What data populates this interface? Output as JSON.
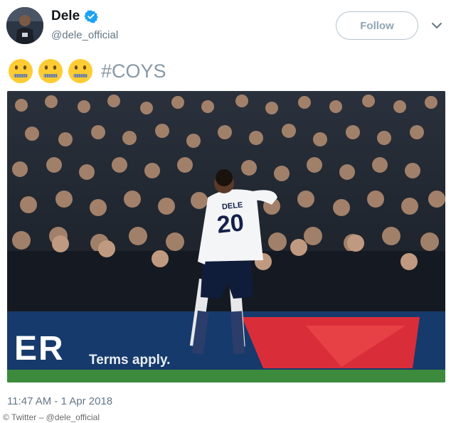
{
  "user": {
    "display_name": "Dele",
    "handle": "@dele_official",
    "verified": true
  },
  "follow_label": "Follow",
  "tweet": {
    "emojis": [
      "zipper-mouth-face",
      "zipper-mouth-face",
      "zipper-mouth-face"
    ],
    "hashtag": "#COYS"
  },
  "photo": {
    "jersey_name": "DELE",
    "jersey_number": "20",
    "ad_text": "Terms apply.",
    "ad_logo_fragment": "ER"
  },
  "timestamp": "11:47 AM - 1 Apr 2018",
  "credit": "© Twitter – @dele_official",
  "colors": {
    "verified": "#1da1f2",
    "follow_border": "#b6c2cc",
    "handle": "#657786",
    "hashtag": "#8899a6",
    "ad_board": "#163a6b",
    "ad_red": "#d92e3a",
    "pitch": "#3c8a3c"
  }
}
